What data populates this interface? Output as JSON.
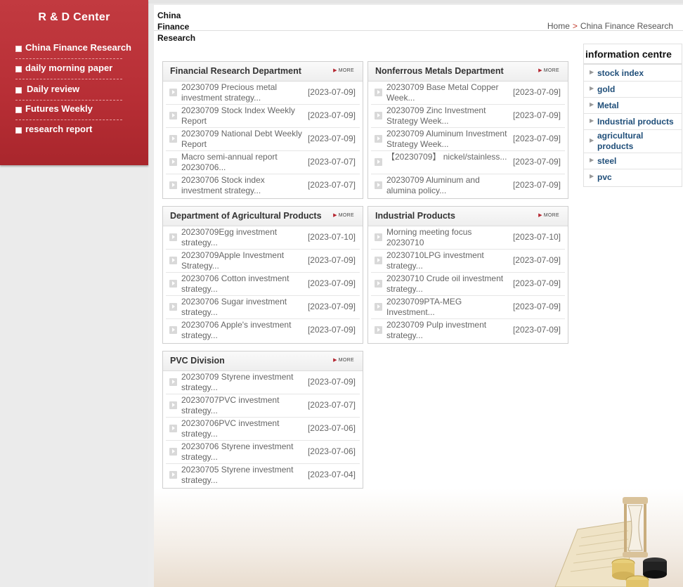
{
  "sidebar": {
    "title": "R & D Center",
    "items": [
      {
        "label": "China Finance Research"
      },
      {
        "label": "daily morning paper"
      },
      {
        "label": "Daily review"
      },
      {
        "label": "Futures Weekly"
      },
      {
        "label": "research report"
      }
    ]
  },
  "header": {
    "brand_line1": "China",
    "brand_line2": "Finance",
    "brand_line3": "Research",
    "breadcrumb_home": "Home",
    "breadcrumb_sep": ">",
    "breadcrumb_current": "China Finance Research"
  },
  "more_label": "MORE",
  "panels": [
    {
      "title": "Financial Research Department",
      "rows": [
        {
          "text": "20230709 Precious metal investment strategy...",
          "date": "[2023-07-09]"
        },
        {
          "text": "20230709 Stock Index Weekly Report",
          "date": "[2023-07-09]"
        },
        {
          "text": "20230709 National Debt Weekly Report",
          "date": "[2023-07-09]"
        },
        {
          "text": "Macro semi-annual report 20230706...",
          "date": "[2023-07-07]"
        },
        {
          "text": "20230706 Stock index investment strategy...",
          "date": "[2023-07-07]"
        }
      ]
    },
    {
      "title": "Nonferrous Metals Department",
      "rows": [
        {
          "text": "20230709 Base Metal Copper Week...",
          "date": "[2023-07-09]"
        },
        {
          "text": "20230709 Zinc Investment Strategy Week...",
          "date": "[2023-07-09]"
        },
        {
          "text": "20230709 Aluminum Investment Strategy Week...",
          "date": "[2023-07-09]"
        },
        {
          "text": "【20230709】 nickel/stainless...",
          "date": "[2023-07-09]"
        },
        {
          "text": "20230709 Aluminum and alumina policy...",
          "date": "[2023-07-09]"
        }
      ]
    },
    {
      "title": "Department of Agricultural Products",
      "rows": [
        {
          "text": "20230709Egg investment strategy...",
          "date": "[2023-07-10]"
        },
        {
          "text": "20230709Apple Investment Strategy...",
          "date": "[2023-07-09]"
        },
        {
          "text": "20230706 Cotton investment strategy...",
          "date": "[2023-07-09]"
        },
        {
          "text": "20230706 Sugar investment strategy...",
          "date": "[2023-07-09]"
        },
        {
          "text": "20230706 Apple's investment strategy...",
          "date": "[2023-07-09]"
        }
      ]
    },
    {
      "title": "Industrial Products",
      "rows": [
        {
          "text": "Morning meeting focus 20230710",
          "date": "[2023-07-10]"
        },
        {
          "text": "20230710LPG investment strategy...",
          "date": "[2023-07-09]"
        },
        {
          "text": "20230710 Crude oil investment strategy...",
          "date": "[2023-07-09]"
        },
        {
          "text": "20230709PTA-MEG Investment...",
          "date": "[2023-07-09]"
        },
        {
          "text": "20230709 Pulp investment strategy...",
          "date": "[2023-07-09]"
        }
      ]
    },
    {
      "title": "PVC Division",
      "rows": [
        {
          "text": "20230709 Styrene investment strategy...",
          "date": "[2023-07-09]"
        },
        {
          "text": "20230707PVC investment strategy...",
          "date": "[2023-07-07]"
        },
        {
          "text": "20230706PVC investment strategy...",
          "date": "[2023-07-06]"
        },
        {
          "text": "20230706 Styrene investment strategy...",
          "date": "[2023-07-06]"
        },
        {
          "text": "20230705 Styrene investment strategy...",
          "date": "[2023-07-04]"
        }
      ]
    }
  ],
  "info": {
    "title": "information centre",
    "items": [
      {
        "label": "stock index"
      },
      {
        "label": "gold"
      },
      {
        "label": "Metal"
      },
      {
        "label": "Industrial products"
      },
      {
        "label": "agricultural products"
      },
      {
        "label": "steel"
      },
      {
        "label": "pvc"
      }
    ]
  }
}
